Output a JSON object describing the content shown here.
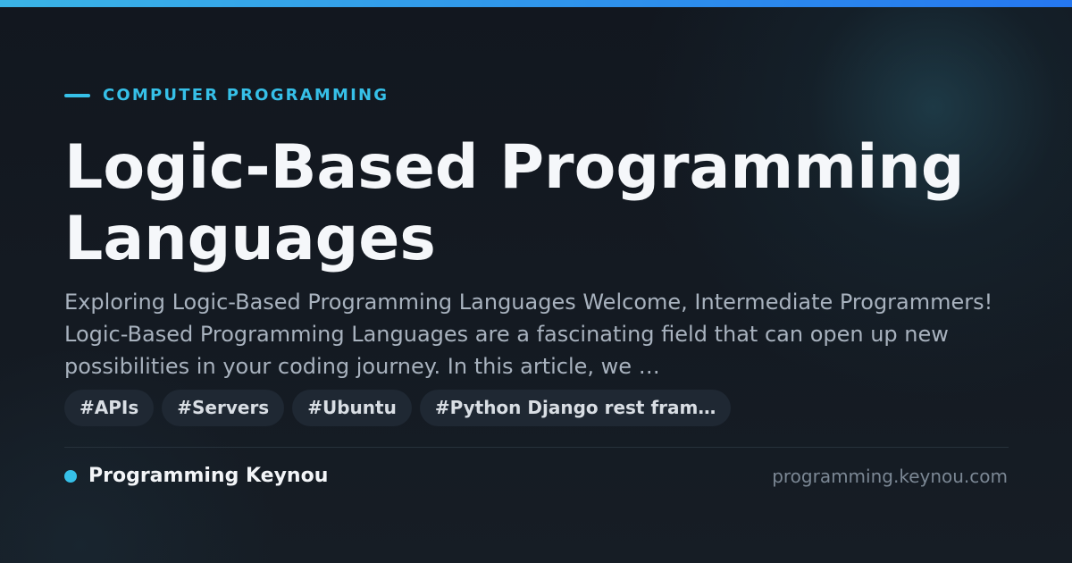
{
  "header": {
    "category": "COMPUTER PROGRAMMING"
  },
  "article": {
    "title": "Logic-Based Programming Languages",
    "description": "Exploring Logic-Based Programming Languages Welcome, Intermediate Programmers! Logic-Based Programming Languages are a fascinating field that can open up new possibilities in your coding journey. In this article, we …"
  },
  "tags": [
    "#APIs",
    "#Servers",
    "#Ubuntu",
    "#Python Django rest fram…"
  ],
  "footer": {
    "brand": "Programming Keynou",
    "domain": "programming.keynou.com"
  },
  "colors": {
    "accent": "#36c0e8",
    "top_gradient_start": "#3ab4e6",
    "top_gradient_end": "#2577f0",
    "background": "#141a22"
  }
}
